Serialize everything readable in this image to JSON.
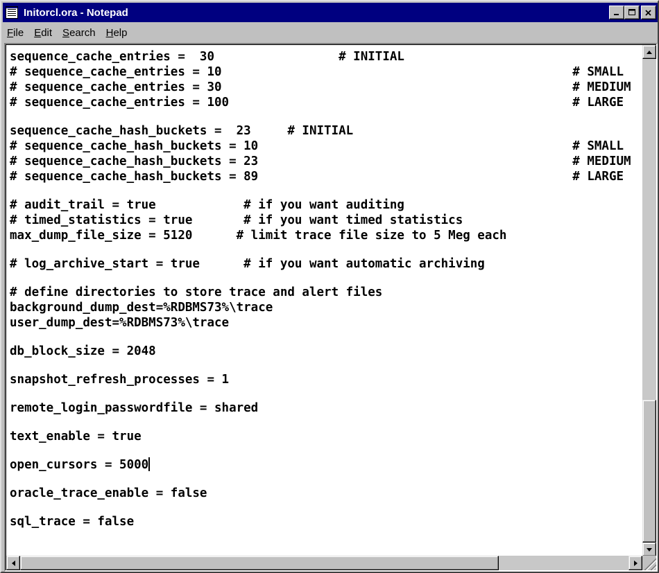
{
  "window": {
    "title": "Initorcl.ora - Notepad",
    "buttons": {
      "minimize": "_",
      "maximize": "□",
      "close": "✕"
    }
  },
  "menu": [
    {
      "prefix": "",
      "accel": "F",
      "rest": "ile"
    },
    {
      "prefix": "",
      "accel": "E",
      "rest": "dit"
    },
    {
      "prefix": "",
      "accel": "S",
      "rest": "earch"
    },
    {
      "prefix": "",
      "accel": "H",
      "rest": "elp"
    }
  ],
  "editor": {
    "lines": [
      "sequence_cache_entries =  30                 # INITIAL",
      "# sequence_cache_entries = 10                                                # SMALL",
      "# sequence_cache_entries = 30                                                # MEDIUM",
      "# sequence_cache_entries = 100                                               # LARGE",
      "",
      "sequence_cache_hash_buckets =  23     # INITIAL",
      "# sequence_cache_hash_buckets = 10                                           # SMALL",
      "# sequence_cache_hash_buckets = 23                                           # MEDIUM",
      "# sequence_cache_hash_buckets = 89                                           # LARGE",
      "",
      "# audit_trail = true            # if you want auditing",
      "# timed_statistics = true       # if you want timed statistics",
      "max_dump_file_size = 5120      # limit trace file size to 5 Meg each",
      "",
      "# log_archive_start = true      # if you want automatic archiving",
      "",
      "# define directories to store trace and alert files",
      "background_dump_dest=%RDBMS73%\\trace",
      "user_dump_dest=%RDBMS73%\\trace",
      "",
      "db_block_size = 2048",
      "",
      "snapshot_refresh_processes = 1",
      "",
      "remote_login_passwordfile = shared",
      "",
      "text_enable = true",
      "",
      "open_cursors = 5000",
      "",
      "oracle_trace_enable = false",
      "",
      "sql_trace = false"
    ],
    "cursor_line_index": 28
  },
  "icons": {
    "app": "notepad-icon",
    "scroll_up": "arrow-up-icon",
    "scroll_down": "arrow-down-icon",
    "scroll_left": "arrow-left-icon",
    "scroll_right": "arrow-right-icon"
  },
  "colors": {
    "titlebar": "#000080",
    "window": "#c0c0c0",
    "editor_bg": "#ffffff"
  }
}
